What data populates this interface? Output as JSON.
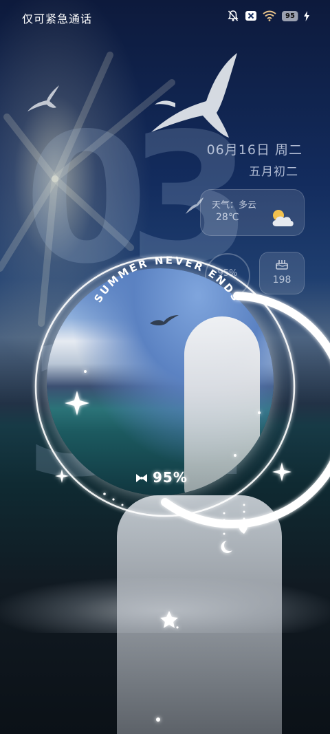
{
  "status_bar": {
    "carrier_text": "仅可紧急通话",
    "battery_level": "95",
    "icons": [
      "mute-icon",
      "no-sim-icon",
      "wifi-icon",
      "battery-icon",
      "charging-icon"
    ]
  },
  "clock": {
    "hour": "03",
    "minute": "32"
  },
  "date": {
    "date_text": "06月16日 周二",
    "lunar_text": "五月初二"
  },
  "weather": {
    "label": "天气：多云",
    "temperature": "28℃",
    "icon": "partly-cloudy-icon"
  },
  "battery_widget": {
    "text": "95%"
  },
  "cake_widget": {
    "icon": "cake-icon",
    "count": "198"
  },
  "center_widget": {
    "arc_text": "SUMMER NEVER ENDS",
    "battery_text": "95%",
    "battery_fraction": 0.95,
    "icon": "bow-icon"
  },
  "colors": {
    "accent": "#ffffff",
    "sky": "#132c5e"
  }
}
